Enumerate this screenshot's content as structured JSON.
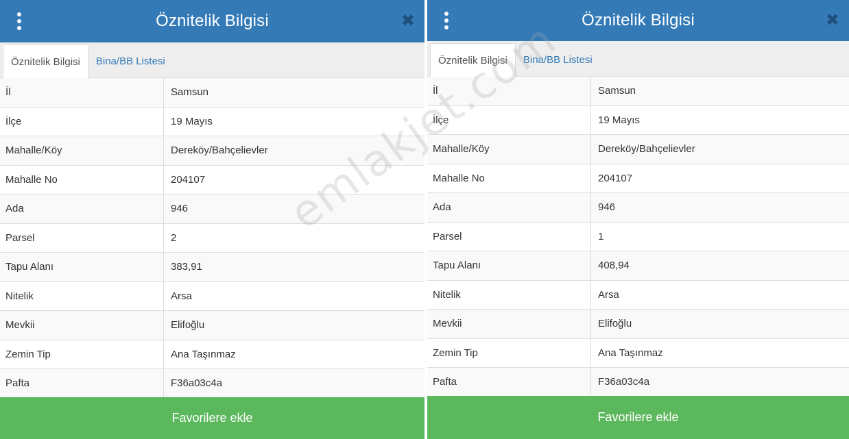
{
  "watermark": "emlakjet.com",
  "panels": [
    {
      "header": {
        "title": "Öznitelik Bilgisi",
        "menu_icon": "kebab-menu-icon",
        "close_icon": "close-icon",
        "close_glyph": "✖"
      },
      "tabs": [
        {
          "label": "Öznitelik Bilgisi",
          "active": true
        },
        {
          "label": "Bina/BB Listesi",
          "active": false
        }
      ],
      "rows": [
        {
          "key": "İl",
          "value": "Samsun"
        },
        {
          "key": "İlçe",
          "value": "19 Mayıs"
        },
        {
          "key": "Mahalle/Köy",
          "value": "Dereköy/Bahçelievler"
        },
        {
          "key": "Mahalle No",
          "value": "204107"
        },
        {
          "key": "Ada",
          "value": "946"
        },
        {
          "key": "Parsel",
          "value": "2"
        },
        {
          "key": "Tapu Alanı",
          "value": "383,91"
        },
        {
          "key": "Nitelik",
          "value": "Arsa"
        },
        {
          "key": "Mevkii",
          "value": "Elifoğlu"
        },
        {
          "key": "Zemin Tip",
          "value": "Ana Taşınmaz"
        },
        {
          "key": "Pafta",
          "value": "F36a03c4a"
        }
      ],
      "button_label": "Favorilere ekle"
    },
    {
      "header": {
        "title": "Öznitelik Bilgisi",
        "menu_icon": "kebab-menu-icon",
        "close_icon": "close-icon",
        "close_glyph": "✖"
      },
      "tabs": [
        {
          "label": "Öznitelik Bilgisi",
          "active": true
        },
        {
          "label": "Bina/BB Listesi",
          "active": false
        }
      ],
      "rows": [
        {
          "key": "İl",
          "value": "Samsun"
        },
        {
          "key": "İlçe",
          "value": "19 Mayıs"
        },
        {
          "key": "Mahalle/Köy",
          "value": "Dereköy/Bahçelievler"
        },
        {
          "key": "Mahalle No",
          "value": "204107"
        },
        {
          "key": "Ada",
          "value": "946"
        },
        {
          "key": "Parsel",
          "value": "1"
        },
        {
          "key": "Tapu Alanı",
          "value": "408,94"
        },
        {
          "key": "Nitelik",
          "value": "Arsa"
        },
        {
          "key": "Mevkii",
          "value": "Elifoğlu"
        },
        {
          "key": "Zemin Tip",
          "value": "Ana Taşınmaz"
        },
        {
          "key": "Pafta",
          "value": "F36a03c4a"
        }
      ],
      "button_label": "Favorilere ekle"
    }
  ],
  "colors": {
    "header": "#337ab7",
    "button": "#5cb85c",
    "tab_link": "#337ab7"
  }
}
